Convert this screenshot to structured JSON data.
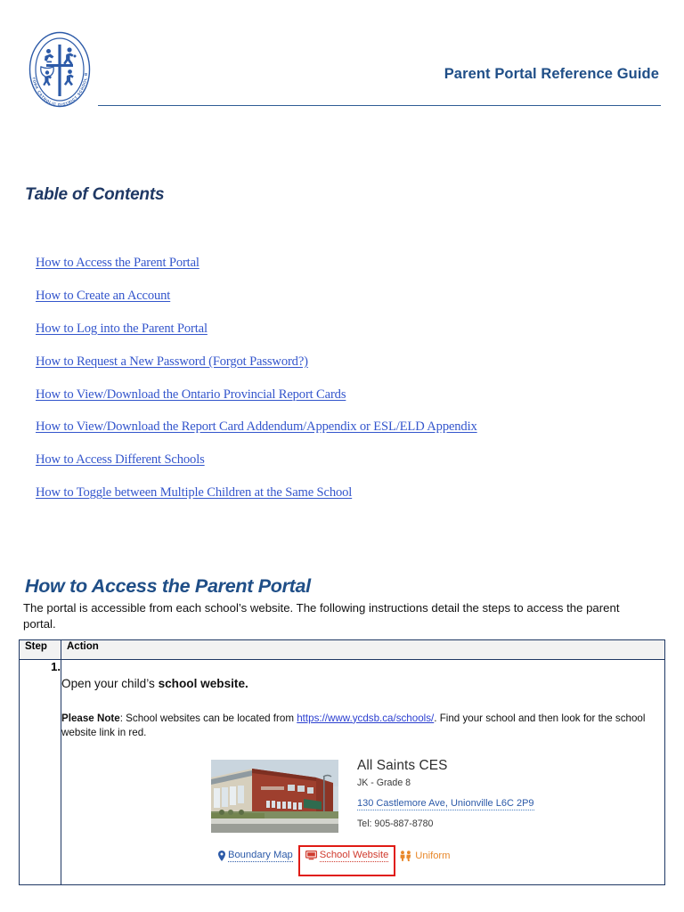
{
  "header": {
    "title": "Parent Portal Reference Guide",
    "logo_alt": "York Catholic District School Board crest",
    "logo_ring_text": "YORK CATHOLIC DISTRICT SCHOOL BOARD",
    "rule_color": "#2F5C94",
    "title_color": "#1F4E87"
  },
  "toc": {
    "heading": "Table of Contents",
    "link_color": "#3355CC",
    "items": [
      {
        "label": "How to Access the Parent Portal"
      },
      {
        "label": "How to Create an Account"
      },
      {
        "label": "How to Log into the Parent Portal"
      },
      {
        "label": "How to Request a New Password (Forgot Password?)"
      },
      {
        "label": "How to View/Download the Ontario Provincial Report Cards"
      },
      {
        "label": "How to View/Download the Report Card Addendum/Appendix or ESL/ELD Appendix"
      },
      {
        "label": "How to Access Different Schools"
      },
      {
        "label": "How to Toggle between Multiple Children at the Same School"
      }
    ]
  },
  "section": {
    "heading": "How to Access the Parent Portal",
    "heading_color": "#1F4E87",
    "intro": "The portal is accessible from each school’s website. The following instructions detail the steps to access the parent portal."
  },
  "table": {
    "headers": {
      "step": "Step",
      "action": "Action"
    },
    "header_bg": "#F2F2F2",
    "border_color": "#1F3864",
    "rows": [
      {
        "step": "1.",
        "action_prefix": "Open your child’s ",
        "action_bold": "school website.",
        "note_label": "Please Note",
        "note_prefix": ": School websites can be located from ",
        "note_link": "https://www.ycdsb.ca/schools/",
        "note_suffix": ".  Find your school and then look for the school website link in red."
      }
    ]
  },
  "school_card": {
    "name": "All Saints CES",
    "grades": "JK - Grade 8",
    "address": "130 Castlemore Ave, Unionville L6C 2P9",
    "telephone": "Tel: 905-887-8780",
    "photo_alt": "Photo of All Saints CES school building",
    "links": [
      {
        "label": "Boundary Map",
        "icon": "map-pin-icon",
        "color": "#2C5AA8",
        "highlighted": false
      },
      {
        "label": "School Website",
        "icon": "monitor-icon",
        "color": "#D03B2E",
        "highlighted": true
      },
      {
        "label": "Uniform",
        "icon": "people-icon",
        "color": "#E8872A",
        "highlighted": false
      }
    ],
    "highlight_color": "#E01B15"
  }
}
